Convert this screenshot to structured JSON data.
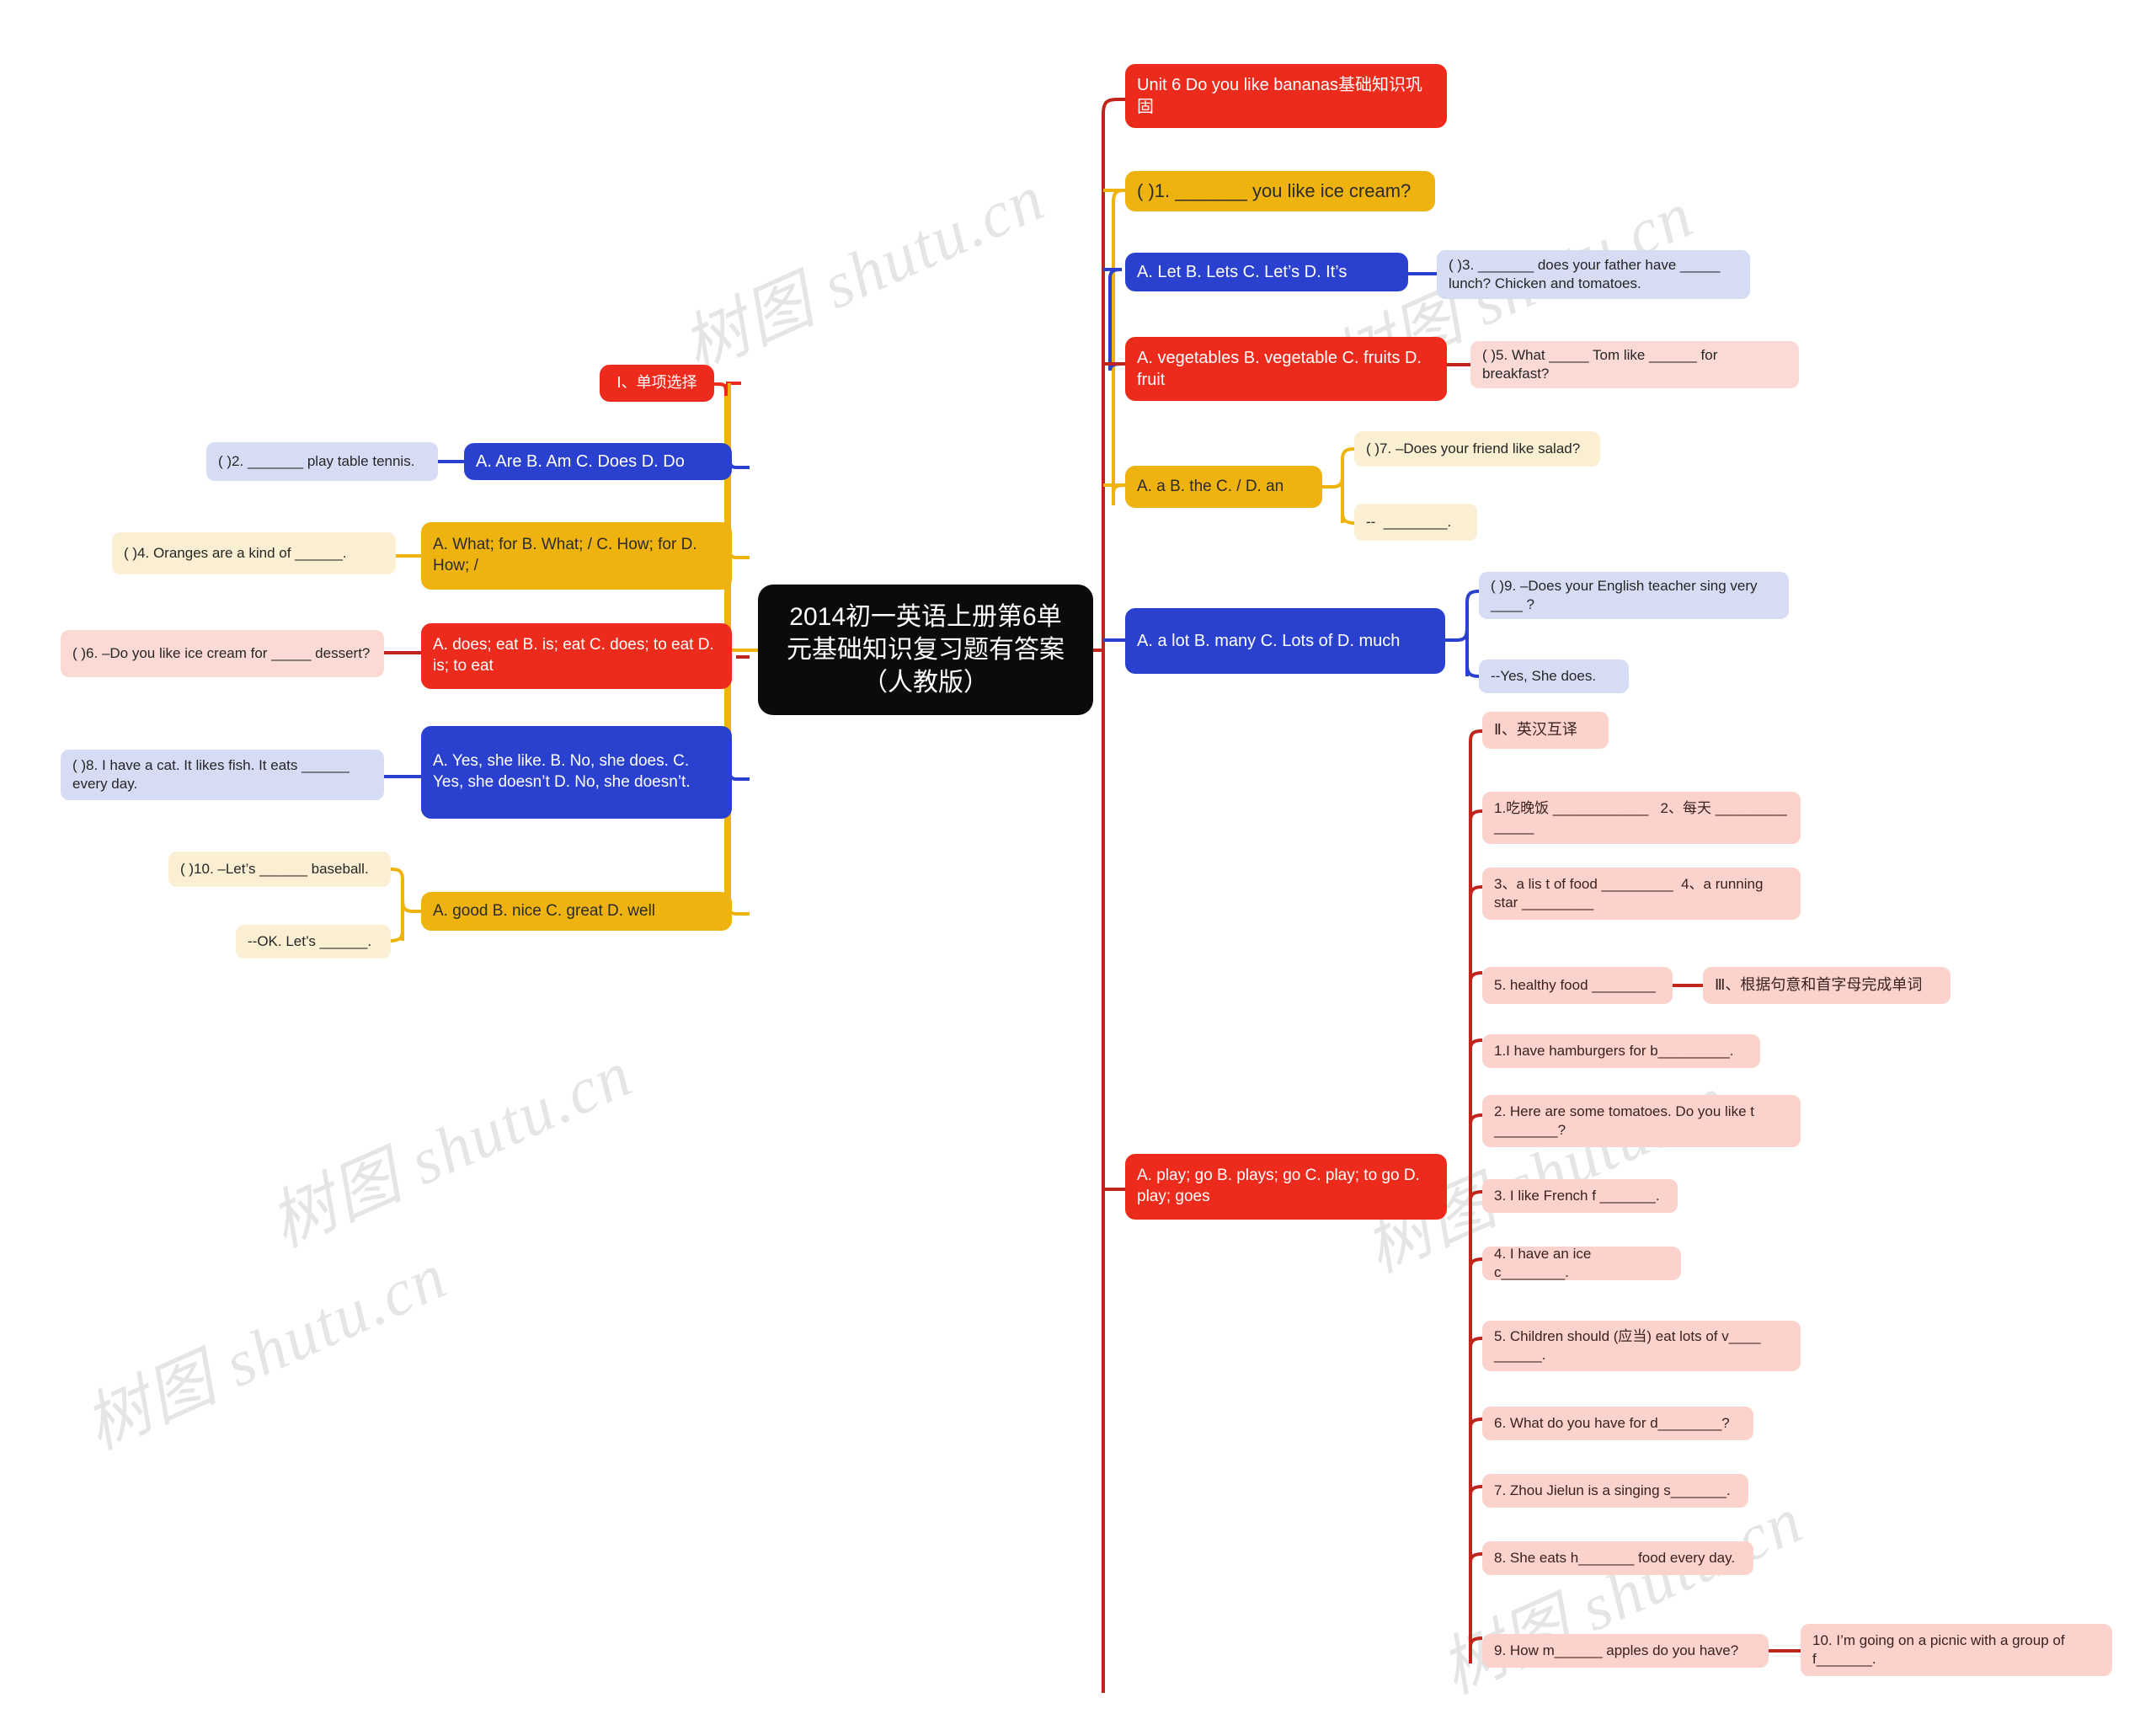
{
  "title": "2014初一英语上册第6单元基础知识复习题有答案（人教版）",
  "watermarks": [
    "树图 shutu.cn",
    "树图 shutu.cn",
    "树图 shutu.cn",
    "树图 shutu.cn",
    "树图 shutu.cn",
    "树图 shutu.cn"
  ],
  "center": {
    "label": "2014初一英语上册第6单\n元基础知识复习题有答案\n（人教版）",
    "color": "#0b0b0b"
  },
  "left_branch": {
    "trunk_color": "#EFB310",
    "nodes": {
      "section1": "Ⅰ、单项选择",
      "q2_choices": "A. Are B. Am C. Does D. Do",
      "q2_stem": "( )2. _______ play table tennis.",
      "q4_choices": "A. What; for B. What; / C. How; for D. How; /",
      "q4_stem": "( )4. Oranges are a kind of ______.",
      "q6_choices": "A. does; eat B. is; eat C. does; to eat D. is; to eat",
      "q6_stem": "( )6. –Do you like ice cream for _____ dessert?",
      "q8_choices": "A. Yes, she like. B. No, she does. C. Yes, she doesn’t D. No, she doesn’t.",
      "q8_stem": "( )8. I have a cat. It likes fish. It eats ______ every day.",
      "q10_choices": "A. good B. nice C. great D. well",
      "q10_stem": "( )10. –Let’s ______ baseball.",
      "q10_reply": "--OK. Let’s ______."
    }
  },
  "right_branch": {
    "trunk_color": "#C0251B",
    "unit_title": "Unit 6 Do you like bananas基础知识巩固",
    "q1_stem": "( )1. _______ you like ice cream?",
    "q3_choices": "A. Let B. Lets C. Let’s D. It’s",
    "q3_stem": "( )3. _______ does your father have _____ lunch? Chicken and tomatoes.",
    "q5_choices": "A. vegetables B. vegetable C. fruits D. fruit",
    "q5_stem": "( )5. What _____ Tom like ______ for breakfast?",
    "q7_choices": "A. a B. the C. / D. an",
    "q7_stem": "( )7. –Does your friend like salad?",
    "q7_reply": "--  ________.",
    "q9_choices": "A. a lot B. many C. Lots of D. much",
    "q9_stem": "( )9. –Does your English teacher sing very ____ ?",
    "q9_reply": "--Yes, She does.",
    "q_play_choices": "A. play; go B. plays; go C. play; to go D. play; goes",
    "section2": "Ⅱ、英汉互译",
    "section3": "Ⅲ、根据句意和首字母完成单词",
    "translate": [
      "1.吃晚饭 ____________   2、每天 _________  _____",
      "3、a lis t of food _________  4、a running star _________",
      "5. healthy food ________"
    ],
    "words": [
      "1.I have hamburgers for b_________.",
      "2. Here are some tomatoes. Do you like t ________?",
      "3. I like French f _______.",
      "4. I have an ice c________.",
      "5. Children should (应当) eat lots of v____  ______.",
      "6. What do you have for d________?",
      "7. Zhou Jielun is a singing s_______.",
      "8. She eats h_______ food every day.",
      "9. How m______ apples do you have?",
      "10. I’m going on a picnic with a group of f_______."
    ]
  },
  "colors": {
    "red": "#ED2B1C",
    "blue": "#2A41CF",
    "yellow": "#EFB310",
    "light_red": "#FBD9D5",
    "light_blue": "#D7DCF5",
    "light_yellow": "#FAEFD2",
    "pink": "#FBD2CC",
    "black": "#0b0b0b"
  }
}
